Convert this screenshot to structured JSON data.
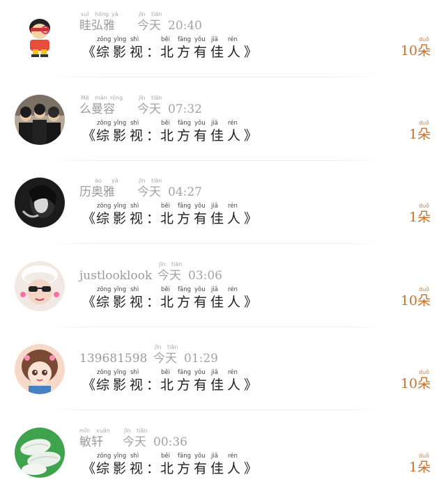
{
  "gift_list": {
    "items": [
      {
        "name": "眭弘雅",
        "name_pinyin": [
          "suī",
          "hóng",
          "yǎ"
        ],
        "time_label": "今天",
        "time_label_pinyin": [
          "jīn",
          "tiān"
        ],
        "time": "20:40",
        "gift_chars": [
          "《",
          "综",
          "影",
          "视",
          "：",
          "北",
          "方",
          "有",
          "佳",
          "人",
          "》"
        ],
        "gift_pinyin": [
          "",
          "zōng",
          "yǐng",
          "shì",
          "",
          "běi",
          "fāng",
          "yǒu",
          "jiā",
          "rén",
          ""
        ],
        "quantity": "10朵",
        "quantity_pinyin": "duǒ"
      },
      {
        "name": "么曼容",
        "name_pinyin": [
          "Mē",
          "màn",
          "róng"
        ],
        "time_label": "今天",
        "time_label_pinyin": [
          "jīn",
          "tiān"
        ],
        "time": "07:32",
        "gift_chars": [
          "《",
          "综",
          "影",
          "视",
          "：",
          "北",
          "方",
          "有",
          "佳",
          "人",
          "》"
        ],
        "gift_pinyin": [
          "",
          "zōng",
          "yǐng",
          "shì",
          "",
          "běi",
          "fāng",
          "yǒu",
          "jiā",
          "rén",
          ""
        ],
        "quantity": "1朵",
        "quantity_pinyin": "duǒ"
      },
      {
        "name": "历奥雅",
        "name_pinyin": [
          "",
          "ào",
          "yǎ"
        ],
        "time_label": "今天",
        "time_label_pinyin": [
          "jīn",
          "tiān"
        ],
        "time": "04:27",
        "gift_chars": [
          "《",
          "综",
          "影",
          "视",
          "：",
          "北",
          "方",
          "有",
          "佳",
          "人",
          "》"
        ],
        "gift_pinyin": [
          "",
          "zōng",
          "yǐng",
          "shì",
          "",
          "běi",
          "fāng",
          "yǒu",
          "jiā",
          "rén",
          ""
        ],
        "quantity": "1朵",
        "quantity_pinyin": "duǒ"
      },
      {
        "name": "justlooklook",
        "name_pinyin": [],
        "time_label": "今天",
        "time_label_pinyin": [
          "jīn",
          "tiān"
        ],
        "time": "03:06",
        "gift_chars": [
          "《",
          "综",
          "影",
          "视",
          "：",
          "北",
          "方",
          "有",
          "佳",
          "人",
          "》"
        ],
        "gift_pinyin": [
          "",
          "zōng",
          "yǐng",
          "shì",
          "",
          "běi",
          "fāng",
          "yǒu",
          "jiā",
          "rén",
          ""
        ],
        "quantity": "10朵",
        "quantity_pinyin": "duǒ"
      },
      {
        "name": "139681598",
        "name_pinyin": [],
        "time_label": "今天",
        "time_label_pinyin": [
          "jīn",
          "tiān"
        ],
        "time": "01:29",
        "gift_chars": [
          "《",
          "综",
          "影",
          "视",
          "：",
          "北",
          "方",
          "有",
          "佳",
          "人",
          "》"
        ],
        "gift_pinyin": [
          "",
          "zōng",
          "yǐng",
          "shì",
          "",
          "běi",
          "fāng",
          "yǒu",
          "jiā",
          "rén",
          ""
        ],
        "quantity": "10朵",
        "quantity_pinyin": "duǒ"
      },
      {
        "name": "敏轩",
        "name_pinyin": [
          "mǐn",
          "xuān"
        ],
        "time_label": "今天",
        "time_label_pinyin": [
          "jīn",
          "tiān"
        ],
        "time": "00:36",
        "gift_chars": [
          "《",
          "综",
          "影",
          "视",
          "：",
          "北",
          "方",
          "有",
          "佳",
          "人",
          "》"
        ],
        "gift_pinyin": [
          "",
          "zōng",
          "yǐng",
          "shì",
          "",
          "běi",
          "fāng",
          "yǒu",
          "jiā",
          "rén",
          ""
        ],
        "quantity": "1朵",
        "quantity_pinyin": "duǒ"
      }
    ]
  },
  "colors": {
    "name_text": "#9b9b9b",
    "gift_text": "#1e1e1e",
    "quantity_text": "#c8722e",
    "divider": "#ececec"
  }
}
